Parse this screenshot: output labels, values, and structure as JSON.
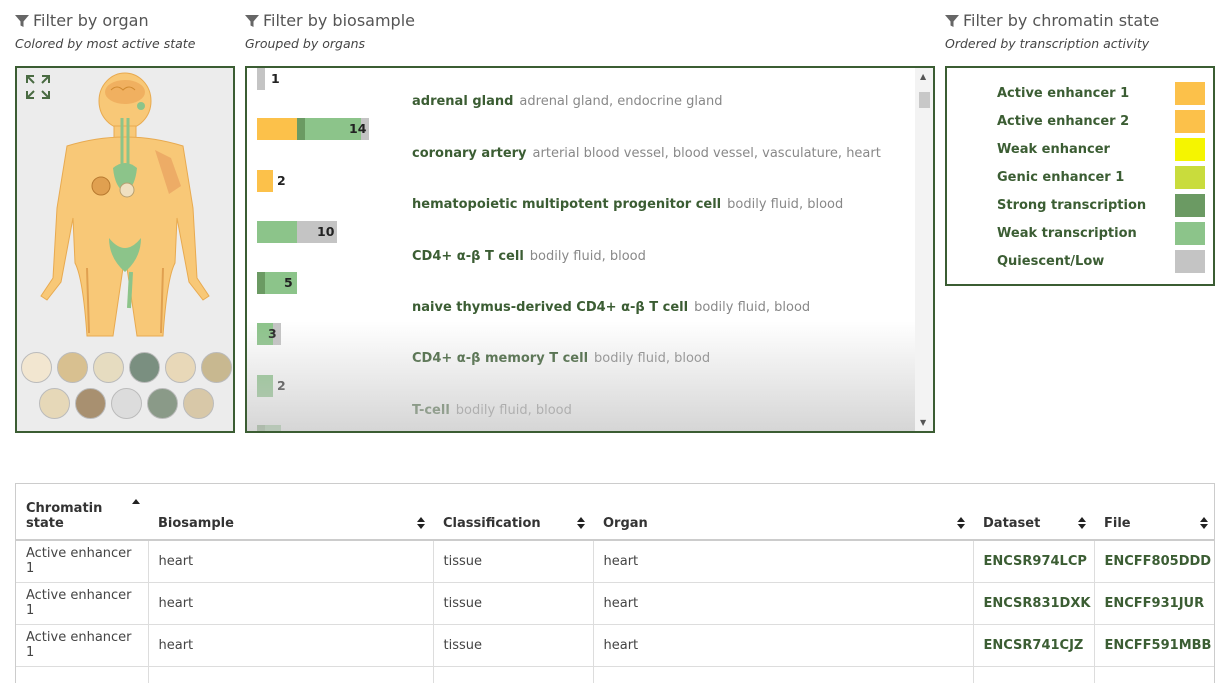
{
  "headers": {
    "organ": {
      "title": "Filter by organ",
      "subtitle": "Colored by most active state"
    },
    "biosample": {
      "title": "Filter by biosample",
      "subtitle": "Grouped by organs"
    },
    "chromatin": {
      "title": "Filter by chromatin state",
      "subtitle": "Ordered by transcription activity"
    }
  },
  "colors": {
    "accent": "#3b5d33",
    "active_enhancer": "#fcc14a",
    "weak_enhancer": "#f5f500",
    "genic_enhancer": "#c9dc3c",
    "strong_transcription": "#6b9a63",
    "weak_transcription": "#8cc48a",
    "quiescent": "#c4c4c4"
  },
  "biosamples": [
    {
      "count": "1",
      "name": "adrenal gland",
      "classification": "adrenal gland, endocrine gland"
    },
    {
      "count": "14",
      "name": "coronary artery",
      "classification": "arterial blood vessel, blood vessel, vasculature, heart"
    },
    {
      "count": "2",
      "name": "hematopoietic multipotent progenitor cell",
      "classification": "bodily fluid, blood"
    },
    {
      "count": "10",
      "name": "CD4+ α-β T cell",
      "classification": "bodily fluid, blood"
    },
    {
      "count": "5",
      "name": "naive thymus-derived CD4+ α-β T cell",
      "classification": "bodily fluid, blood"
    },
    {
      "count": "3",
      "name": "CD4+ α-β memory T cell",
      "classification": "bodily fluid, blood"
    },
    {
      "count": "2",
      "name": "T-cell",
      "classification": "bodily fluid, blood"
    }
  ],
  "chromatin_states": [
    {
      "label": "Active enhancer 1",
      "color": "#fcc14a"
    },
    {
      "label": "Active enhancer 2",
      "color": "#fcc14a"
    },
    {
      "label": "Weak enhancer",
      "color": "#f5f500"
    },
    {
      "label": "Genic enhancer 1",
      "color": "#c9dc3c"
    },
    {
      "label": "Strong transcription",
      "color": "#6b9a63"
    },
    {
      "label": "Weak transcription",
      "color": "#8cc48a"
    },
    {
      "label": "Quiescent/Low",
      "color": "#c4c4c4"
    }
  ],
  "table": {
    "columns": [
      "Chromatin state",
      "Biosample",
      "Classification",
      "Organ",
      "Dataset",
      "File"
    ],
    "rows": [
      [
        "Active enhancer 1",
        "heart",
        "tissue",
        "heart",
        "ENCSR974LCP",
        "ENCFF805DDD"
      ],
      [
        "Active enhancer 1",
        "heart",
        "tissue",
        "heart",
        "ENCSR831DXK",
        "ENCFF931JUR"
      ],
      [
        "Active enhancer 1",
        "heart",
        "tissue",
        "heart",
        "ENCSR741CJZ",
        "ENCFF591MBB"
      ],
      [
        "",
        "",
        "",
        "",
        "",
        ""
      ]
    ]
  }
}
